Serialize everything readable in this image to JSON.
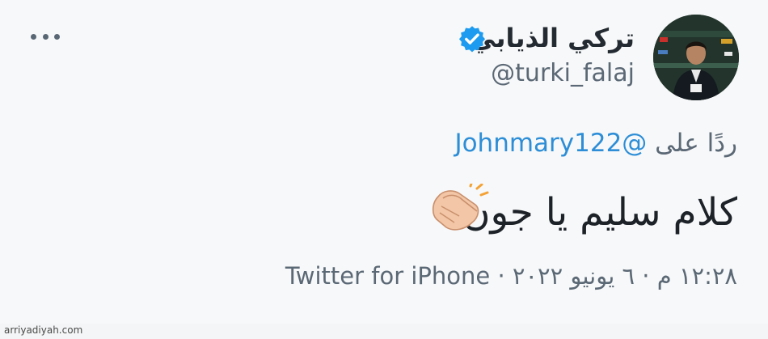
{
  "tweet": {
    "display_name": "تركي الذيابي",
    "handle": "@turki_falaj",
    "reply_prefix": "ردًا على",
    "reply_mention": "@Johnmary122",
    "text": "كلام سليم يا جون",
    "timestamp": "١٢:٢٨ م · ٦ يونيو ٢٠٢٢",
    "separator": "·",
    "source": "Twitter for iPhone"
  },
  "watermark": "arriyadiyah.com",
  "icons": {
    "more": "more-dots-icon",
    "verified": "verified-badge-icon",
    "emoji": "clapping-hands-emoji"
  },
  "colors": {
    "verified": "#1d9bf0",
    "mention": "#2d8ed7",
    "text": "#1c2228",
    "muted": "#5b6875"
  }
}
